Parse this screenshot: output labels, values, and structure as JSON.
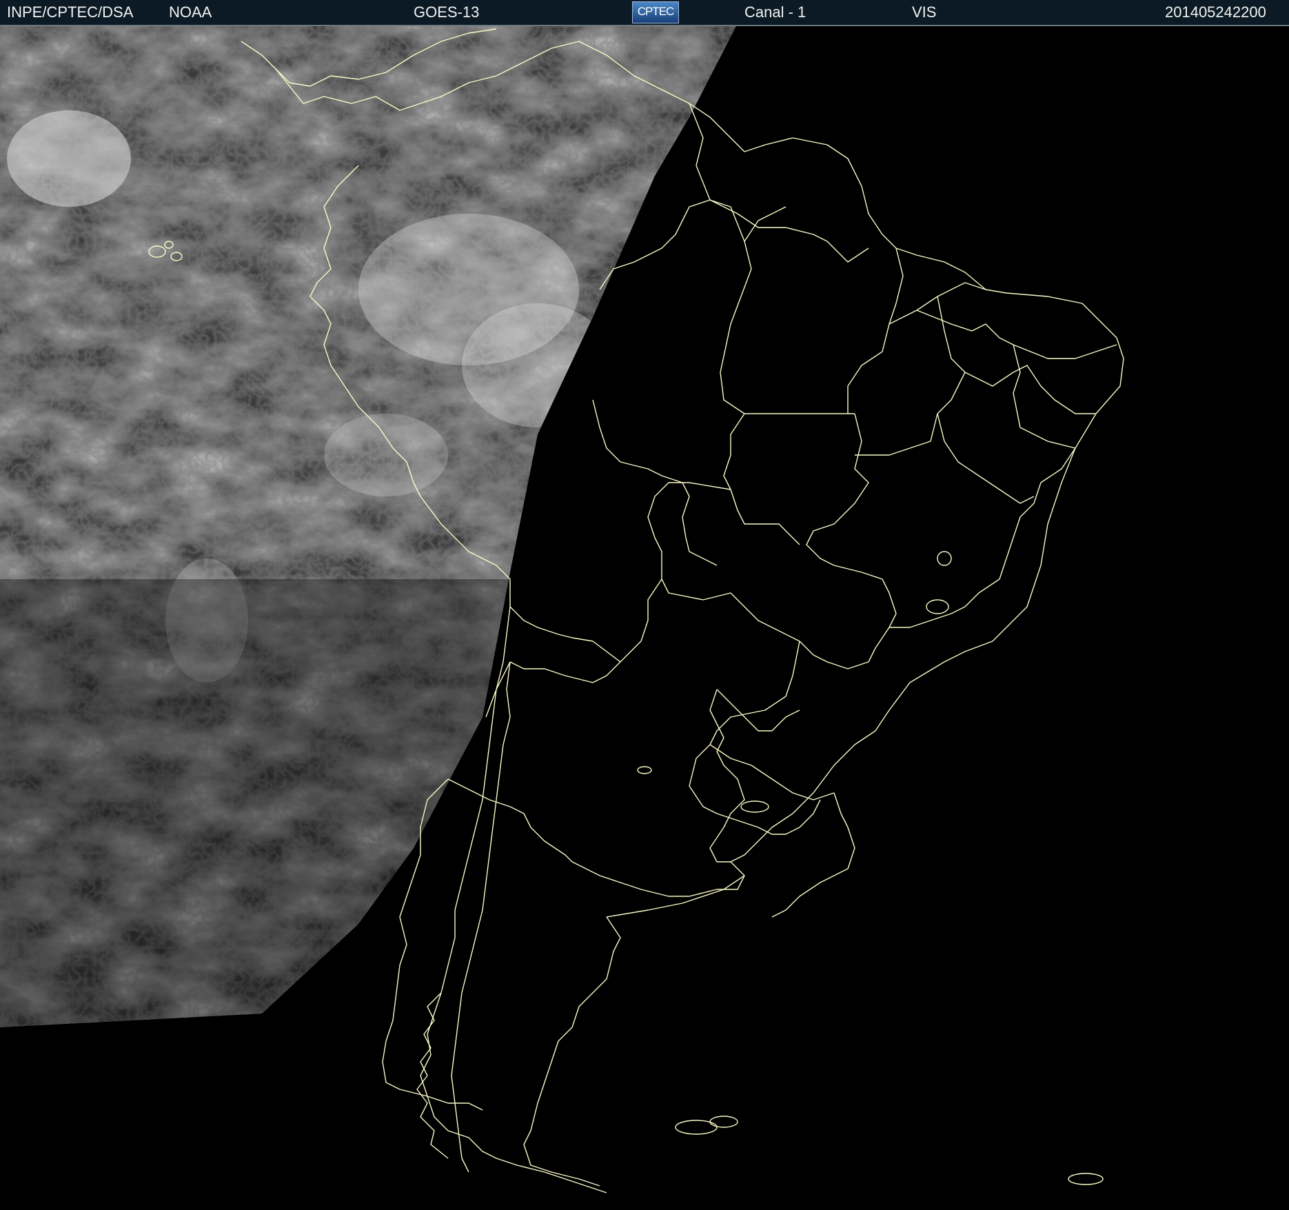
{
  "header": {
    "institution": "INPE/CPTEC/DSA",
    "agency": "NOAA",
    "satellite": "GOES-13",
    "logo_text": "CPTEC",
    "channel": "Canal - 1",
    "band": "VIS",
    "timestamp": "201405242200"
  },
  "colors": {
    "background": "#000000",
    "header_bar": "#0b1a24",
    "header_text": "#f2f2f2",
    "borders": "#fafac8",
    "cloud_imagery": "#8c8c8c"
  },
  "map": {
    "projection": "satellite visible image",
    "region": "South America",
    "daylight_side": "west",
    "night_side": "east"
  }
}
